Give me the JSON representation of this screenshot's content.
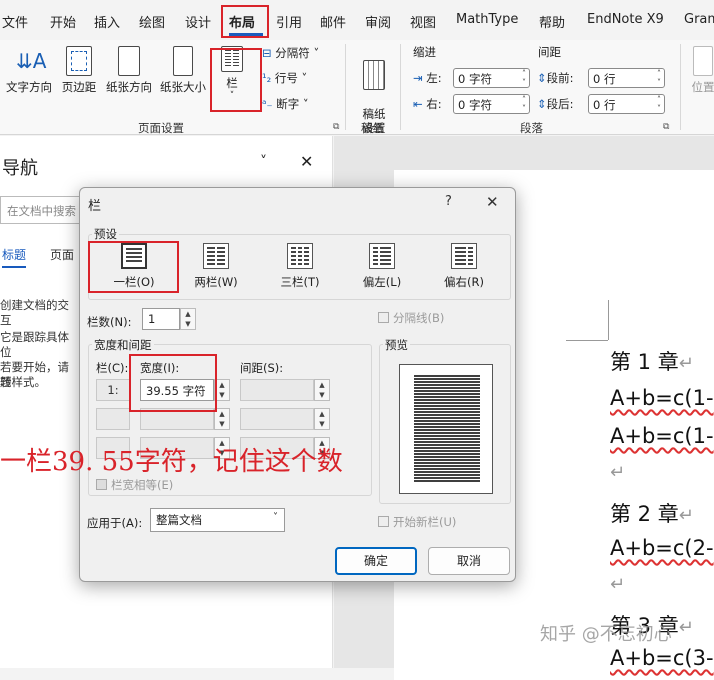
{
  "ribbon": {
    "tabs": [
      "文件",
      "开始",
      "插入",
      "绘图",
      "设计",
      "布局",
      "引用",
      "邮件",
      "审阅",
      "视图",
      "MathType",
      "帮助",
      "EndNote X9",
      "Gram"
    ],
    "active_tab": "布局",
    "page_setup": {
      "text_direction": "文字方向",
      "margins": "页边距",
      "orientation": "纸张方向",
      "size": "纸张大小",
      "columns": "栏",
      "breaks": "分隔符 ˅",
      "line_numbers": "行号 ˅",
      "hyphenation": "断字 ˅",
      "group_label": "页面设置"
    },
    "manuscript": {
      "button": "稿纸\n设置",
      "group_label": "稿纸"
    },
    "paragraph": {
      "indent_label": "缩进",
      "spacing_label": "间距",
      "indent_left_label": "左:",
      "indent_left_value": "0 字符",
      "indent_right_label": "右:",
      "indent_right_value": "0 字符",
      "space_before_label": "段前:",
      "space_before_value": "0 行",
      "space_after_label": "段后:",
      "space_after_value": "0 行",
      "group_label": "段落"
    },
    "position_label": "位置"
  },
  "nav": {
    "title": "导航",
    "search_placeholder": "在文档中搜索",
    "tabs": [
      "标题",
      "页面"
    ],
    "text1": "创建文档的交互",
    "text2": "它是跟踪具体位",
    "text3a": "若要开始，请转",
    "text3b": "题样式。"
  },
  "dialog": {
    "title": "栏",
    "help": "?",
    "presets_label": "预设",
    "presets": [
      "一栏(O)",
      "两栏(W)",
      "三栏(T)",
      "偏左(L)",
      "偏右(R)"
    ],
    "num_columns_label": "栏数(N):",
    "num_columns_value": "1",
    "line_between_label": "分隔线(B)",
    "width_spacing_label": "宽度和间距",
    "preview_label": "预览",
    "col_header": "栏(C):",
    "width_header": "宽度(I):",
    "spacing_header": "间距(S):",
    "row1_col": "1:",
    "row1_width": "39.55 字符",
    "equal_width_label": "栏宽相等(E)",
    "apply_to_label": "应用于(A):",
    "apply_to_value": "整篇文档",
    "start_new_column_label": "开始新栏(U)",
    "ok": "确定",
    "cancel": "取消"
  },
  "document": {
    "ch1": "第 1 章",
    "ch2": "第 2 章",
    "ch3": "第 3 章",
    "line1": "A+b=c(1-",
    "line2": "A+b=c(1-",
    "line3": "A+b=c(2-",
    "line4": "A+b=c(3-"
  },
  "annotation": "一栏39. 55字符，记住这个数",
  "watermark": "知乎 @不忘初心",
  "colors": {
    "annotation_red": "#d9232a",
    "primary_blue": "#0067c0"
  }
}
